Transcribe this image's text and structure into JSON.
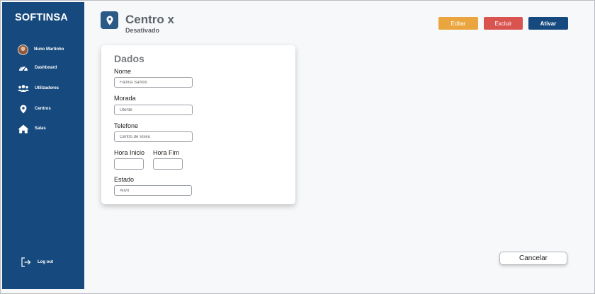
{
  "sidebar": {
    "brand": "SOFTINSA",
    "user_name": "Nuno Martinho",
    "items": [
      {
        "label": "Dashboard",
        "icon": "dashboard-gauge-icon"
      },
      {
        "label": "Utilizadores",
        "icon": "users-icon"
      },
      {
        "label": "Centros",
        "icon": "map-pin-icon"
      },
      {
        "label": "Salas",
        "icon": "home-icon"
      }
    ],
    "logout_label": "Log out",
    "logout_icon": "logout-icon"
  },
  "header": {
    "icon": "map-pin-icon",
    "title": "Centro x",
    "subtitle": "Desativado",
    "buttons": {
      "edit": "Editar",
      "delete": "Excluir",
      "activate": "Ativar"
    }
  },
  "form": {
    "title": "Dados",
    "nome": {
      "label": "Nome",
      "placeholder": "Fátima Santos"
    },
    "morada": {
      "label": "Morada",
      "placeholder": "Utente"
    },
    "telefone": {
      "label": "Telefone",
      "placeholder": "Centro de Viseu"
    },
    "hora_inicio": {
      "label": "Hora Inicio",
      "value": ""
    },
    "hora_fim": {
      "label": "Hora Fim",
      "value": ""
    },
    "estado": {
      "label": "Estado",
      "placeholder": "Ativo"
    }
  },
  "footer": {
    "cancel_label": "Cancelar"
  },
  "colors": {
    "sidebar_bg": "#164a7e",
    "edit": "#eaa53e",
    "delete": "#d9534f",
    "activate": "#164a7e"
  }
}
